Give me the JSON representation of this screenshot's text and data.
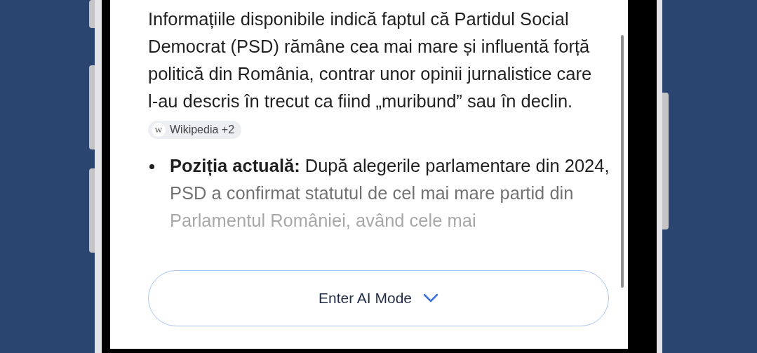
{
  "answer": {
    "paragraph": "Informațiile disponibile indică faptul că Partidul Social Democrat (PSD) rămâne cea mai mare și influentă forță politică din România, contrar unor opinii jurnalistice care l-au descris în trecut ca fiind „muribund” sau în declin.",
    "citation": {
      "icon": "W",
      "label": "Wikipedia +2"
    },
    "bullets": [
      {
        "text": "**Poziția actuală:** După alegerile parlamentare din 2024, PSD a confirmat statutul de cel mai mare partid din Parlamentul României, având cele mai"
      }
    ]
  },
  "button": {
    "label": "Enter AI Mode"
  }
}
